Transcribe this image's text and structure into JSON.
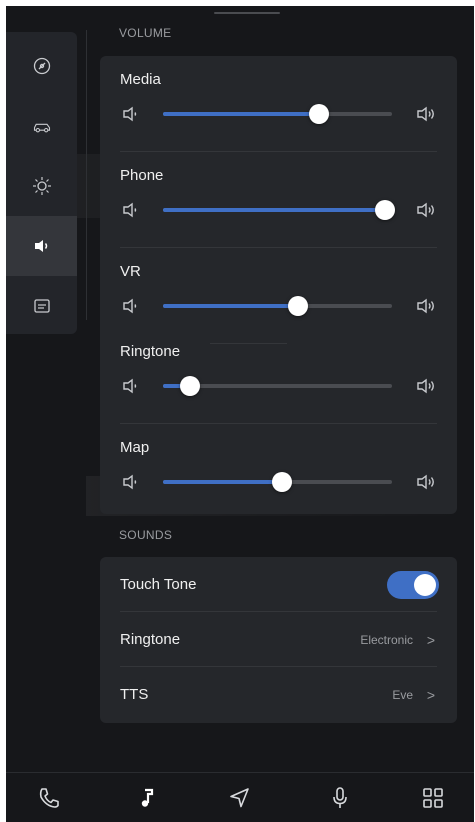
{
  "volume": {
    "section_title": "VOLUME",
    "sliders": [
      {
        "label": "Media",
        "level": 0.68
      },
      {
        "label": "Phone",
        "level": 0.97
      },
      {
        "label": "VR",
        "level": 0.59
      },
      {
        "label": "Ringtone",
        "level": 0.12
      },
      {
        "label": "Map",
        "level": 0.52
      }
    ]
  },
  "sounds": {
    "section_title": "SOUNDS",
    "touch_tone": {
      "label": "Touch Tone",
      "on": true
    },
    "ringtone": {
      "label": "Ringtone",
      "value": "Electronic",
      "chevron": ">"
    },
    "tts": {
      "label": "TTS",
      "value": "Eve",
      "chevron": ">"
    }
  },
  "sidebar": {
    "items": [
      {
        "icon": "gauge-icon",
        "active": false
      },
      {
        "icon": "car-icon",
        "active": false
      },
      {
        "icon": "brightness-icon",
        "active": false
      },
      {
        "icon": "volume-icon",
        "active": true
      },
      {
        "icon": "display-icon",
        "active": false
      }
    ]
  },
  "bottom_nav": [
    "phone-icon",
    "music-note-icon",
    "navigation-icon",
    "microphone-icon",
    "apps-grid-icon"
  ],
  "colors": {
    "accent": "#3f6fc5",
    "background": "#16171a",
    "card": "#25272b"
  }
}
